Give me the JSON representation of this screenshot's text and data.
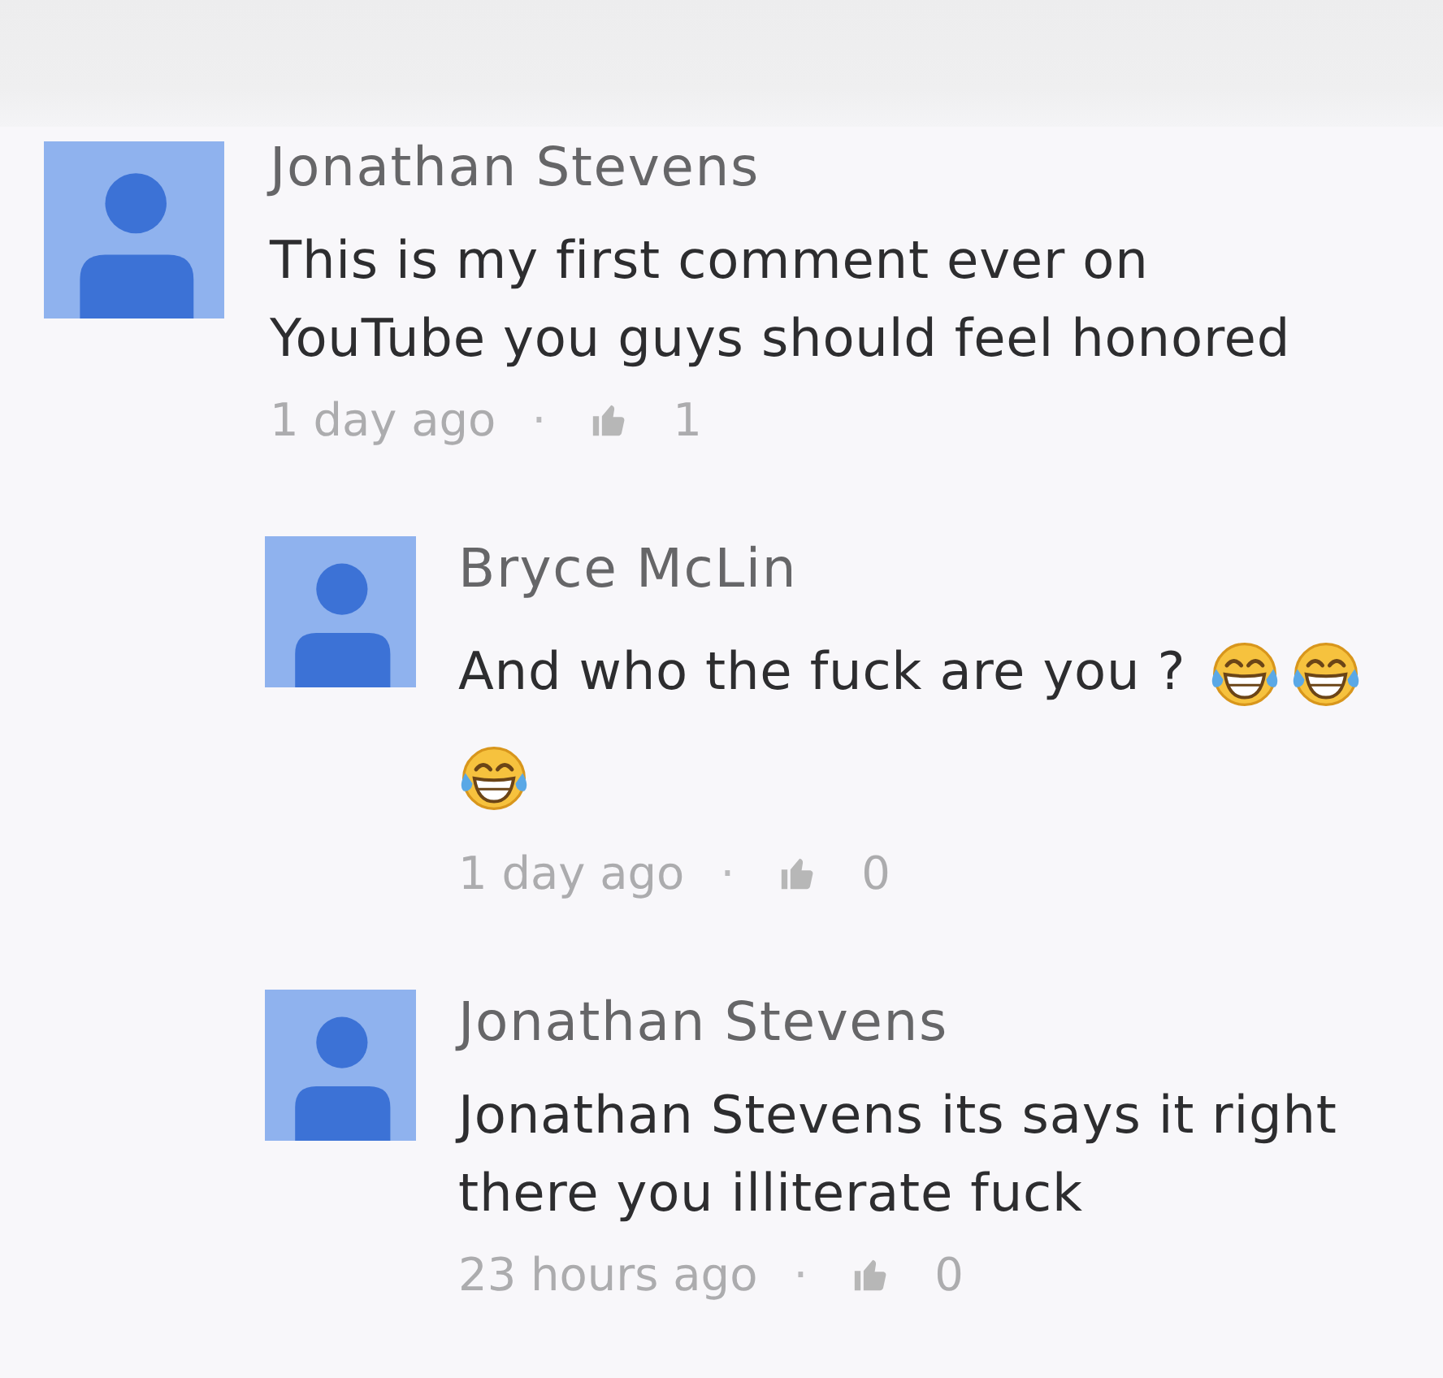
{
  "comments": [
    {
      "author": "Jonathan Stevens",
      "text": "This is my first comment ever on YouTube you guys should feel honored",
      "time": "1 day ago",
      "separator": "·",
      "likes": "1",
      "replies": [
        {
          "author": "Bryce McLin",
          "text": "And who the fuck are you ?",
          "emojis": [
            {
              "kind": "tears-of-joy"
            },
            {
              "kind": "tears-of-joy"
            },
            {
              "kind": "tears-of-joy"
            }
          ],
          "time": "1 day ago",
          "separator": "·",
          "likes": "0"
        },
        {
          "author": "Jonathan Stevens",
          "text": "Jonathan Stevens its says it right there you illiterate fuck",
          "time": "23 hours ago",
          "separator": "·",
          "likes": "0"
        }
      ]
    }
  ]
}
